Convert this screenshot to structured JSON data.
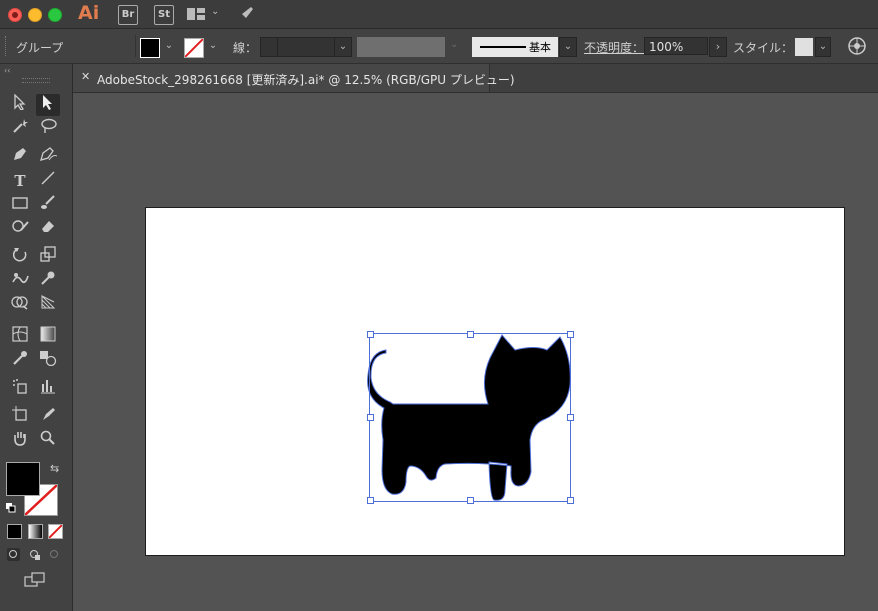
{
  "window": {
    "app_logo": "Ai",
    "bridge_label": "Br",
    "stock_label": "St"
  },
  "controlbar": {
    "selection_label": "グループ",
    "stroke_label": "線：",
    "brush_label": "基本",
    "opacity_label": "不透明度：",
    "opacity_value": "100%",
    "style_label": "スタイル："
  },
  "document": {
    "tab_title": "AdobeStock_298261668 [更新済み].ai* @ 12.5% (RGB/GPU プレビュー)"
  },
  "colors": {
    "fill": "#000000",
    "stroke": "#ffffff",
    "accent": "#e07c4d",
    "selection": "#4e6ed8"
  },
  "icons": [
    "selection-icon",
    "direct-selection-icon",
    "magic-wand-icon",
    "lasso-icon",
    "pen-icon",
    "curvature-icon",
    "type-icon",
    "line-icon",
    "rectangle-icon",
    "paintbrush-icon",
    "shaper-icon",
    "eraser-icon",
    "rotate-icon",
    "scale-icon",
    "warp-icon",
    "puppet-warp-icon",
    "shape-builder-icon",
    "perspective-grid-icon",
    "mesh-icon",
    "gradient-icon",
    "eyedropper-icon",
    "blend-icon",
    "symbol-sprayer-icon",
    "column-graph-icon",
    "artboard-icon",
    "slice-icon",
    "hand-icon",
    "zoom-icon"
  ]
}
